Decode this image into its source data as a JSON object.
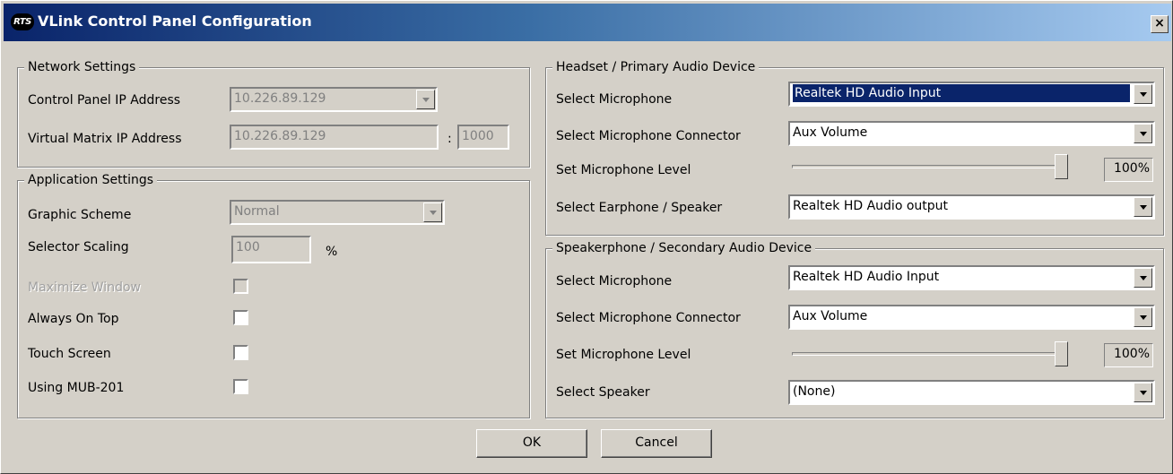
{
  "window": {
    "title": "VLink Control Panel Configuration",
    "logo_text": "RTS",
    "close_glyph": "×"
  },
  "network": {
    "legend": "Network Settings",
    "cp_ip_label": "Control Panel IP Address",
    "cp_ip_value": "10.226.89.129",
    "vm_ip_label": "Virtual Matrix IP Address",
    "vm_ip_value": "10.226.89.129",
    "port_sep": ":",
    "vm_port_value": "1000"
  },
  "app": {
    "legend": "Application Settings",
    "graphic_scheme_label": "Graphic Scheme",
    "graphic_scheme_value": "Normal",
    "selector_scaling_label": "Selector Scaling",
    "selector_scaling_value": "100",
    "selector_scaling_unit": "%",
    "maximize_label": "Maximize Window",
    "always_on_top_label": "Always On Top",
    "touch_screen_label": "Touch Screen",
    "mub_label": "Using MUB-201"
  },
  "headset": {
    "legend": "Headset / Primary Audio Device",
    "mic_label": "Select Microphone",
    "mic_value": "Realtek HD Audio Input",
    "connector_label": "Select Microphone Connector",
    "connector_value": "Aux Volume",
    "level_label": "Set Microphone Level",
    "level_value": "100%",
    "level_fraction": 1.0,
    "speaker_label": "Select Earphone / Speaker",
    "speaker_value": "Realtek HD Audio output"
  },
  "speakerphone": {
    "legend": "Speakerphone / Secondary Audio Device",
    "mic_label": "Select Microphone",
    "mic_value": "Realtek HD Audio Input",
    "connector_label": "Select Microphone Connector",
    "connector_value": "Aux Volume",
    "level_label": "Set Microphone Level",
    "level_value": "100%",
    "level_fraction": 1.0,
    "speaker_label": "Select Speaker",
    "speaker_value": "(None)"
  },
  "buttons": {
    "ok": "OK",
    "cancel": "Cancel"
  }
}
